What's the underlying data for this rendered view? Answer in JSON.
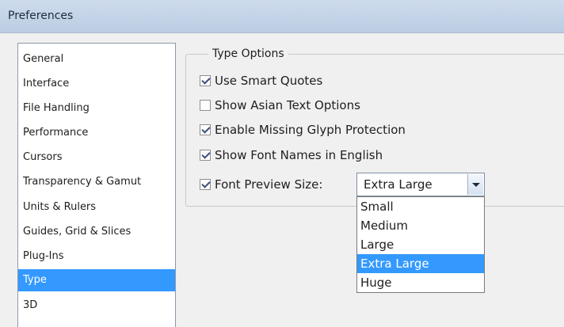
{
  "window": {
    "title": "Preferences"
  },
  "sidebar": {
    "items": [
      {
        "label": "General"
      },
      {
        "label": "Interface"
      },
      {
        "label": "File Handling"
      },
      {
        "label": "Performance"
      },
      {
        "label": "Cursors"
      },
      {
        "label": "Transparency & Gamut"
      },
      {
        "label": "Units & Rulers"
      },
      {
        "label": "Guides, Grid & Slices"
      },
      {
        "label": "Plug-Ins"
      },
      {
        "label": "Type",
        "selected": true
      },
      {
        "label": "3D"
      }
    ]
  },
  "type_options": {
    "legend": "Type Options",
    "checkboxes": [
      {
        "label": "Use Smart Quotes",
        "checked": true
      },
      {
        "label": "Show Asian Text Options",
        "checked": false
      },
      {
        "label": "Enable Missing Glyph Protection",
        "checked": true
      },
      {
        "label": "Show Font Names in English",
        "checked": true
      },
      {
        "label": "Font Preview Size:",
        "checked": true
      }
    ],
    "font_preview_size": {
      "value": "Extra Large",
      "options": [
        "Small",
        "Medium",
        "Large",
        "Extra Large",
        "Huge"
      ],
      "highlighted": "Extra Large"
    }
  },
  "colors": {
    "selection": "#3399ff",
    "titlebar": "#c4d4e8"
  }
}
